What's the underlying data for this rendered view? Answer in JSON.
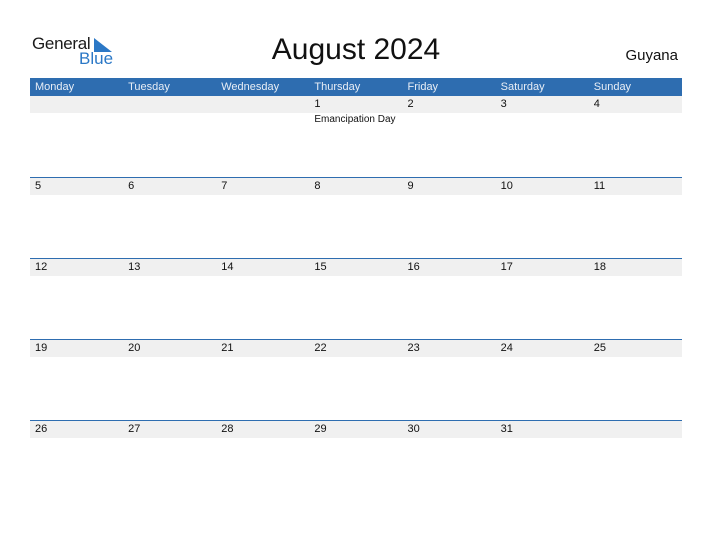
{
  "logo": {
    "line1": "General",
    "line2": "Blue"
  },
  "title": "August 2024",
  "country": "Guyana",
  "colors": {
    "accent": "#2e6db0",
    "strip": "#f0f0f0",
    "logo_blue": "#2b78c6"
  },
  "weekdays": [
    "Monday",
    "Tuesday",
    "Wednesday",
    "Thursday",
    "Friday",
    "Saturday",
    "Sunday"
  ],
  "weeks": [
    {
      "days": [
        {
          "num": "",
          "holiday": ""
        },
        {
          "num": "",
          "holiday": ""
        },
        {
          "num": "",
          "holiday": ""
        },
        {
          "num": "1",
          "holiday": "Emancipation Day"
        },
        {
          "num": "2",
          "holiday": ""
        },
        {
          "num": "3",
          "holiday": ""
        },
        {
          "num": "4",
          "holiday": ""
        }
      ]
    },
    {
      "days": [
        {
          "num": "5",
          "holiday": ""
        },
        {
          "num": "6",
          "holiday": ""
        },
        {
          "num": "7",
          "holiday": ""
        },
        {
          "num": "8",
          "holiday": ""
        },
        {
          "num": "9",
          "holiday": ""
        },
        {
          "num": "10",
          "holiday": ""
        },
        {
          "num": "11",
          "holiday": ""
        }
      ]
    },
    {
      "days": [
        {
          "num": "12",
          "holiday": ""
        },
        {
          "num": "13",
          "holiday": ""
        },
        {
          "num": "14",
          "holiday": ""
        },
        {
          "num": "15",
          "holiday": ""
        },
        {
          "num": "16",
          "holiday": ""
        },
        {
          "num": "17",
          "holiday": ""
        },
        {
          "num": "18",
          "holiday": ""
        }
      ]
    },
    {
      "days": [
        {
          "num": "19",
          "holiday": ""
        },
        {
          "num": "20",
          "holiday": ""
        },
        {
          "num": "21",
          "holiday": ""
        },
        {
          "num": "22",
          "holiday": ""
        },
        {
          "num": "23",
          "holiday": ""
        },
        {
          "num": "24",
          "holiday": ""
        },
        {
          "num": "25",
          "holiday": ""
        }
      ]
    },
    {
      "days": [
        {
          "num": "26",
          "holiday": ""
        },
        {
          "num": "27",
          "holiday": ""
        },
        {
          "num": "28",
          "holiday": ""
        },
        {
          "num": "29",
          "holiday": ""
        },
        {
          "num": "30",
          "holiday": ""
        },
        {
          "num": "31",
          "holiday": ""
        },
        {
          "num": "",
          "holiday": ""
        }
      ]
    }
  ]
}
